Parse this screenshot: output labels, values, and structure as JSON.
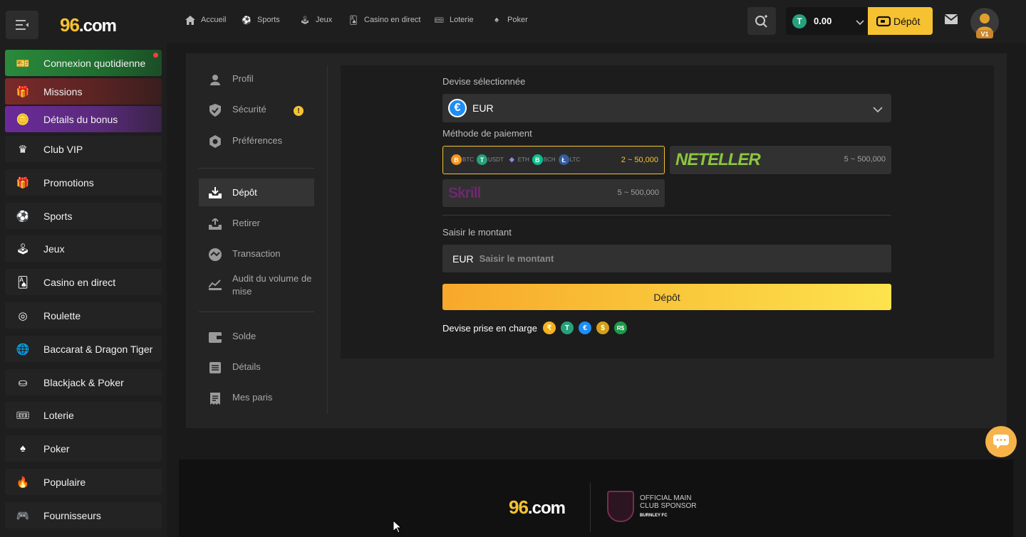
{
  "brand": {
    "logo_num": "96",
    "logo_text": ".com"
  },
  "sidebar": {
    "items": [
      {
        "label": "Connexion quotidienne",
        "icon": "calendar-gift-icon"
      },
      {
        "label": "Missions",
        "icon": "gift-box-icon"
      },
      {
        "label": "Détails du bonus",
        "icon": "coins-icon"
      },
      {
        "label": "Club VIP",
        "icon": "crown-icon"
      },
      {
        "label": "Promotions",
        "icon": "gift-icon"
      },
      {
        "label": "Sports",
        "icon": "soccer-ball-icon"
      },
      {
        "label": "Jeux",
        "icon": "joystick-icon"
      },
      {
        "label": "Casino en direct",
        "icon": "cards-icon"
      },
      {
        "label": "Roulette",
        "icon": "roulette-icon"
      },
      {
        "label": "Baccarat & Dragon Tiger",
        "icon": "globe-icon"
      },
      {
        "label": "Blackjack & Poker",
        "icon": "poker-chip-icon"
      },
      {
        "label": "Loterie",
        "icon": "ticket-icon"
      },
      {
        "label": "Poker",
        "icon": "spade-icon"
      },
      {
        "label": "Populaire",
        "icon": "fire-icon"
      },
      {
        "label": "Fournisseurs",
        "icon": "gamepad-icon"
      }
    ]
  },
  "topnav": {
    "items": [
      {
        "label": "Accueil",
        "icon": "home-icon"
      },
      {
        "label": "Sports",
        "icon": "soccer-ball-icon"
      },
      {
        "label": "Jeux",
        "icon": "joystick-icon"
      },
      {
        "label": "Casino en direct",
        "icon": "cards-icon"
      },
      {
        "label": "Loterie",
        "icon": "ticket-icon"
      },
      {
        "label": "Poker",
        "icon": "spade-icon"
      }
    ],
    "balance": "0.00",
    "balance_currency_symbol": "T",
    "deposit_label": "Dépôt",
    "vip_badge": "V1"
  },
  "account_menu": {
    "group1": [
      {
        "label": "Profil",
        "icon": "user-icon"
      },
      {
        "label": "Sécurité",
        "icon": "shield-icon",
        "warning": "!"
      },
      {
        "label": "Préférences",
        "icon": "settings-icon"
      }
    ],
    "group2": [
      {
        "label": "Dépôt",
        "icon": "deposit-tray-icon",
        "active": true
      },
      {
        "label": "Retirer",
        "icon": "withdraw-tray-icon"
      },
      {
        "label": "Transaction",
        "icon": "exchange-icon"
      },
      {
        "label": "Audit du volume de mise",
        "icon": "chart-icon"
      }
    ],
    "group3": [
      {
        "label": "Solde",
        "icon": "wallet-icon"
      },
      {
        "label": "Détails",
        "icon": "document-icon"
      },
      {
        "label": "Mes paris",
        "icon": "receipt-icon"
      }
    ]
  },
  "deposit": {
    "currency_label": "Devise sélectionnée",
    "currency_symbol": "€",
    "currency": "EUR",
    "method_label": "Méthode de paiement",
    "methods": [
      {
        "type": "crypto",
        "coins": [
          {
            "symbol": "B",
            "name": "BTC",
            "color": "#f7931a"
          },
          {
            "symbol": "T",
            "name": "USDT",
            "color": "#26a17b"
          },
          {
            "symbol": "◆",
            "name": "ETH",
            "color": "#627eea"
          },
          {
            "symbol": "B",
            "name": "BCH",
            "color": "#0ac18e"
          },
          {
            "symbol": "Ł",
            "name": "LTC",
            "color": "#345d9d"
          }
        ],
        "range": "2 ~ 50,000",
        "selected": true
      },
      {
        "type": "neteller",
        "name": "NETELLER",
        "range": "5 ~ 500,000",
        "selected": false
      },
      {
        "type": "skrill",
        "name": "Skrill",
        "range": "5 ~ 500,000",
        "selected": false
      }
    ],
    "amount_label": "Saisir le montant",
    "amount_currency": "EUR",
    "amount_placeholder": "Saisir le montant",
    "submit_label": "Dépôt",
    "supported_label": "Devise prise en charge",
    "supported": [
      {
        "symbol": "₹",
        "color": "#f6b11c"
      },
      {
        "symbol": "T",
        "color": "#26a17b"
      },
      {
        "symbol": "€",
        "color": "#1e8ef5"
      },
      {
        "symbol": "$",
        "color": "#d4a017"
      },
      {
        "symbol": "R$",
        "color": "#1c9b4a"
      }
    ]
  },
  "footer": {
    "sponsor_line1": "OFFICIAL MAIN",
    "sponsor_line2": "CLUB SPONSOR",
    "club": "BURNLEY FC"
  },
  "colors": {
    "accent": "#f6c231",
    "bg": "#1a1a1a",
    "panel": "#242424"
  }
}
